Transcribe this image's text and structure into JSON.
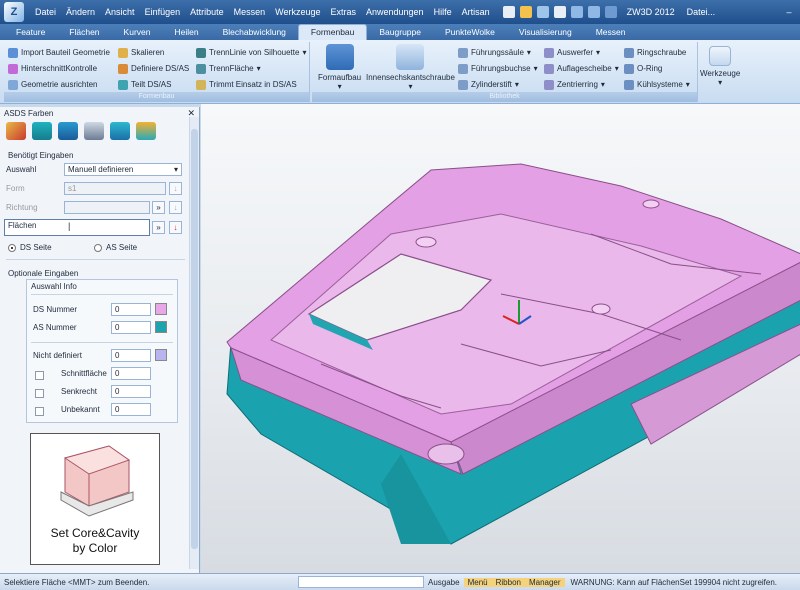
{
  "menubar": {
    "items": [
      "Datei",
      "Ändern",
      "Ansicht",
      "Einfügen",
      "Attribute",
      "Messen",
      "Werkzeuge",
      "Extras",
      "Anwendungen",
      "Hilfe",
      "Artisan"
    ],
    "app_title": "ZW3D 2012",
    "title_right": "Datei..."
  },
  "ribbon_tabs": [
    "Feature",
    "Flächen",
    "Kurven",
    "Heilen",
    "Blechabwicklung",
    "Formenbau",
    "Baugruppe",
    "PunkteWolke",
    "Visualisierung",
    "Messen"
  ],
  "active_tab": "Formenbau",
  "ribbon": {
    "formenbau": {
      "label": "Formenbau",
      "col1": [
        "Import Bauteil Geometrie",
        "HinterschnittKontrolle",
        "Geometrie ausrichten"
      ],
      "col2": [
        "Skalieren",
        "Definiere DS/AS",
        "Teilt DS/AS"
      ],
      "col3": [
        "TrennLinie von Silhouette",
        "TrennFläche",
        "Trimmt Einsatz in DS/AS"
      ]
    },
    "bibliothek": {
      "label": "Bibliothek",
      "big1": "Formaufbau",
      "big2": "Innensechskantschraube",
      "col1": [
        "Führungssäule",
        "Führungsbuchse",
        "Zylinderstift"
      ],
      "col2": [
        "Auswerfer",
        "Auflagescheibe",
        "Zentrierring"
      ],
      "col3": [
        "Ringschraube",
        "O-Ring",
        "Kühlsysteme"
      ]
    },
    "werkzeuge": "Werkzeuge"
  },
  "panel": {
    "title": "ASDS Farben",
    "required_label": "Benötigt Eingaben",
    "auswahl_label": "Auswahl",
    "auswahl_value": "Manuell definieren",
    "form_label": "Form",
    "form_value": "s1",
    "richtung_label": "Richtung",
    "flaechen_label": "Flächen",
    "ds_seite": "DS Seite",
    "as_seite": "AS Seite",
    "optional_label": "Optionale Eingaben",
    "auswahl_info": "Auswahl Info",
    "ds_nummer_label": "DS Nummer",
    "ds_nummer": "0",
    "as_nummer_label": "AS Nummer",
    "as_nummer": "0",
    "nicht_definiert_label": "Nicht definiert",
    "nicht_definiert": "0",
    "schnittflaeche_label": "Schnittfläche",
    "schnittflaeche": "0",
    "senkrecht_label": "Senkrecht",
    "senkrecht": "0",
    "unbekannt_label": "Unbekannt",
    "unbekannt": "0",
    "promo_line1": "Set Core&Cavity",
    "promo_line2": "by Color"
  },
  "colors": {
    "ds": "#e8a8e8",
    "as": "#1ca3ad",
    "undefined": "#b8b4f0"
  },
  "status": {
    "left": "Selektiere Fläche  <MMT> zum Beenden.",
    "tabs": [
      "Ausgabe",
      "Menü",
      "Ribbon",
      "Manager"
    ],
    "warning": "WARNUNG: Kann auf FlächenSet 199904 nicht zugreifen."
  }
}
